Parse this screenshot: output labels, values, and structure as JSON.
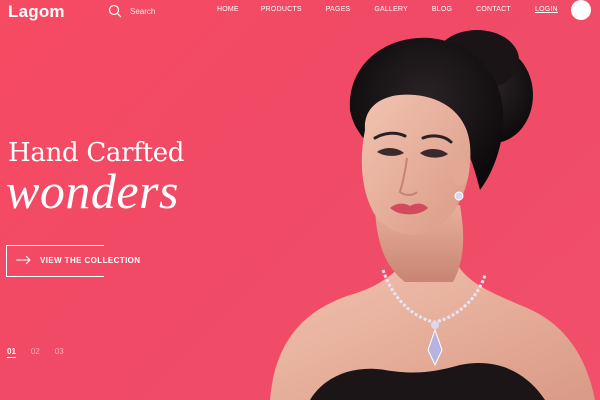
{
  "header": {
    "logo": "Lagom",
    "search_placeholder": "Search",
    "nav": [
      "HOME",
      "PRODUCTS",
      "PAGES",
      "GALLERY",
      "BLOG",
      "CONTACT"
    ],
    "login": "LOGIN"
  },
  "hero": {
    "headline_line1": "Hand Carfted",
    "headline_line2": "wonders",
    "cta_label": "VIEW THE COLLECTION",
    "pager": [
      "01",
      "02",
      "03"
    ],
    "active_slide": "01"
  },
  "colors": {
    "background": "#f34b65",
    "text": "#ffffff"
  }
}
